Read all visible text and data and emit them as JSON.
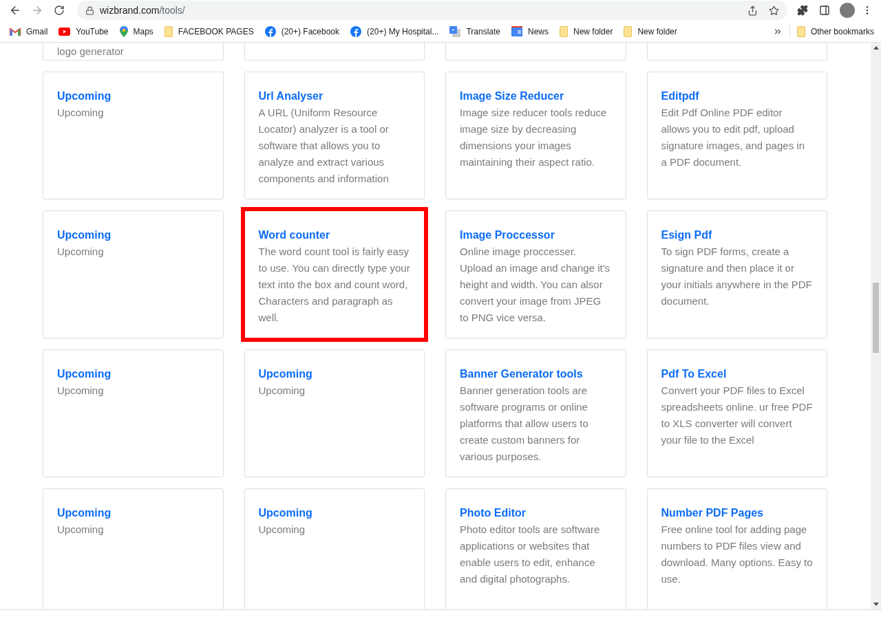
{
  "browser": {
    "url_host": "wizbrand.com",
    "url_path": "/tools/",
    "bookmarks": [
      {
        "kind": "gmail",
        "label": "Gmail"
      },
      {
        "kind": "youtube",
        "label": "YouTube"
      },
      {
        "kind": "maps",
        "label": "Maps"
      },
      {
        "kind": "folder",
        "label": "FACEBOOK PAGES"
      },
      {
        "kind": "facebook",
        "label": "(20+) Facebook"
      },
      {
        "kind": "facebook",
        "label": "(20+) My Hospital..."
      },
      {
        "kind": "translate",
        "label": "Translate"
      },
      {
        "kind": "news",
        "label": "News"
      },
      {
        "kind": "folder",
        "label": "New folder"
      },
      {
        "kind": "folder",
        "label": "New folder"
      }
    ],
    "other_bookmarks": "Other bookmarks"
  },
  "partial_row": {
    "descriptions": [
      "logo generator"
    ]
  },
  "tool_cards": [
    [
      {
        "title": "Upcoming",
        "description": "Upcoming",
        "highlighted": false
      },
      {
        "title": "Url Analyser",
        "description": "A URL (Uniform Resource Locator) analyzer is a tool or software that allows you to analyze and extract various components and information",
        "highlighted": false
      },
      {
        "title": "Image Size Reducer",
        "description": "Image size reducer tools reduce image size by decreasing dimensions your images maintaining their aspect ratio.",
        "highlighted": false
      },
      {
        "title": "Editpdf",
        "description": "Edit Pdf Online PDF editor allows you to edit pdf, upload signature images, and pages in a PDF document.",
        "highlighted": false
      }
    ],
    [
      {
        "title": "Upcoming",
        "description": "Upcoming",
        "highlighted": false
      },
      {
        "title": "Word counter",
        "description": "The word count tool is fairly easy to use. You can directly type your text into the box and count word, Characters and paragraph as well.",
        "highlighted": true
      },
      {
        "title": "Image Proccessor",
        "description": "Online image proccesser. Upload an image and change it's height and width. You can alsor convert your image from JPEG to PNG vice versa.",
        "highlighted": false
      },
      {
        "title": "Esign Pdf",
        "description": "To sign PDF forms, create a signature and then place it or your initials anywhere in the PDF document.",
        "highlighted": false
      }
    ],
    [
      {
        "title": "Upcoming",
        "description": "Upcoming",
        "highlighted": false
      },
      {
        "title": "Upcoming",
        "description": "Upcoming",
        "highlighted": false
      },
      {
        "title": "Banner Generator tools",
        "description": "Banner generation tools are software programs or online platforms that allow users to create custom banners for various purposes.",
        "highlighted": false
      },
      {
        "title": "Pdf To Excel",
        "description": "Convert your PDF files to Excel spreadsheets online. ur free PDF to XLS converter will convert your file to the Excel",
        "highlighted": false
      }
    ],
    [
      {
        "title": "Upcoming",
        "description": "Upcoming",
        "highlighted": false
      },
      {
        "title": "Upcoming",
        "description": "Upcoming",
        "highlighted": false
      },
      {
        "title": "Photo Editor",
        "description": "Photo editor tools are software applications or websites that enable users to edit, enhance and digital photographs.",
        "highlighted": false
      },
      {
        "title": "Number PDF Pages",
        "description": "Free online tool for adding page numbers to PDF files view and download. Many options. Easy to use.",
        "highlighted": false
      }
    ]
  ]
}
